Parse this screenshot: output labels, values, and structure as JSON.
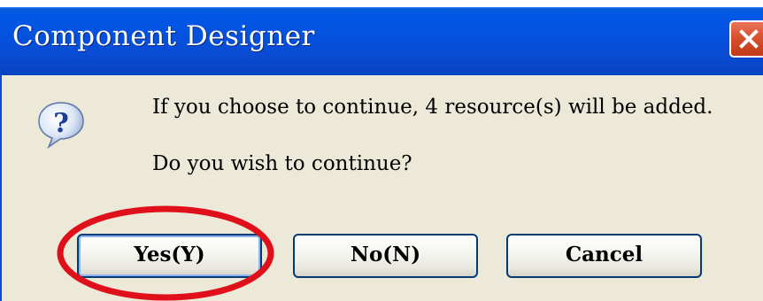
{
  "window": {
    "title": "Component Designer"
  },
  "dialog": {
    "icon": "question-icon",
    "message_line1": "If you choose to continue, 4 resource(s) will be added.",
    "message_line2": "Do you wish to continue?"
  },
  "buttons": {
    "yes_label": "Yes(Y)",
    "no_label": "No(N)",
    "cancel_label": "Cancel"
  },
  "annotation": {
    "highlight_color": "#e0101a",
    "highlighted": "yes-button"
  },
  "colors": {
    "titlebar": "#0550dd",
    "close_button": "#d8512f",
    "client_background": "#ece9d8",
    "button_border": "#003c74"
  }
}
